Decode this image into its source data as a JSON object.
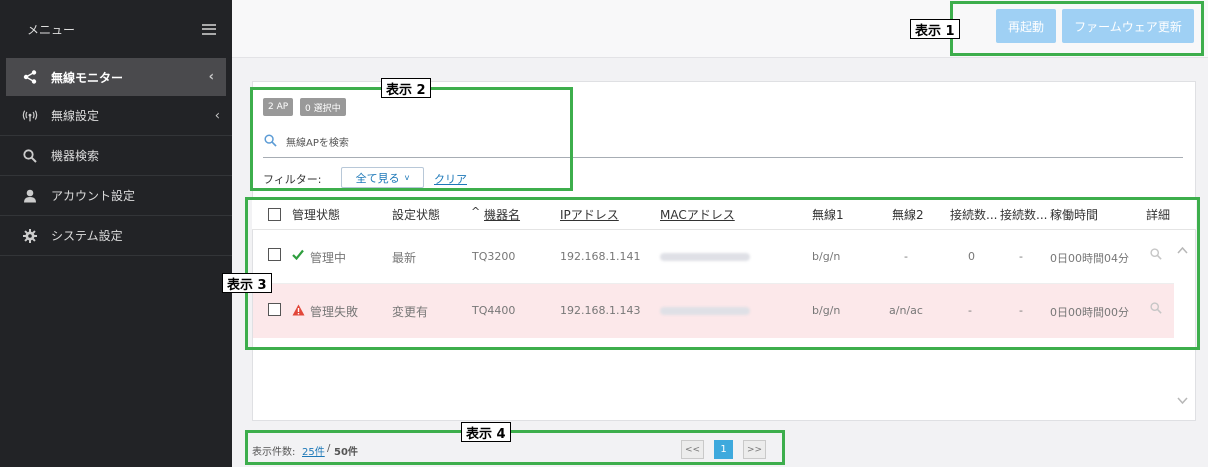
{
  "sidebar": {
    "menu_title": "メニュー",
    "items": [
      {
        "label": "無線モニター",
        "icon": "share-icon",
        "active": true,
        "has_chevron": true
      },
      {
        "label": "無線設定",
        "icon": "wireless-signal-icon",
        "active": false,
        "has_chevron": true
      },
      {
        "label": "機器検索",
        "icon": "search-icon",
        "active": false,
        "has_chevron": false
      },
      {
        "label": "アカウント設定",
        "icon": "user-icon",
        "active": false,
        "has_chevron": false
      },
      {
        "label": "システム設定",
        "icon": "gear-icon",
        "active": false,
        "has_chevron": false
      }
    ]
  },
  "toolbar": {
    "restart_label": "再起動",
    "firmware_label": "ファームウェア更新"
  },
  "annotations": {
    "a1": "表示 1",
    "a2": "表示 2",
    "a3": "表示 3",
    "a4": "表示 4"
  },
  "badges": {
    "ap_count": "2 AP",
    "selected": "0 選択中"
  },
  "search": {
    "placeholder": "無線APを検索"
  },
  "filter": {
    "label": "フィルター:",
    "view_all": "全て見る",
    "clear": "クリア"
  },
  "table": {
    "headers": {
      "mgmt": "管理状態",
      "config": "設定状態",
      "sort_arrow": "^",
      "model": "機器名",
      "ip": "IPアドレス",
      "mac": "MACアドレス",
      "radio1": "無線1",
      "radio2": "無線2",
      "conn1": "接続数...",
      "conn2": "接続数...",
      "uptime": "稼働時間",
      "detail": "詳細"
    },
    "rows": [
      {
        "mgmt": "管理中",
        "status": "ok",
        "config": "最新",
        "model": "TQ3200",
        "ip": "192.168.1.141",
        "radio1": "b/g/n",
        "radio2": "-",
        "conn1": "0",
        "conn2": "-",
        "uptime": "0日00時間04分"
      },
      {
        "mgmt": "管理失敗",
        "status": "error",
        "config": "変更有",
        "model": "TQ4400",
        "ip": "192.168.1.143",
        "radio1": "b/g/n",
        "radio2": "a/n/ac",
        "conn1": "-",
        "conn2": "-",
        "uptime": "0日00時間00分"
      }
    ]
  },
  "footer": {
    "count_label": "表示件数:",
    "per_page": "25件",
    "separator": "/",
    "total": "50件",
    "prev": "<<",
    "page": "1",
    "next": ">>"
  },
  "colors": {
    "accent": "#3ea9dd",
    "button": "#9fd0f4",
    "annotation": "#3dae4c",
    "error_row": "#fce8ea",
    "ok": "#2e9e3e",
    "error": "#e2473a"
  }
}
